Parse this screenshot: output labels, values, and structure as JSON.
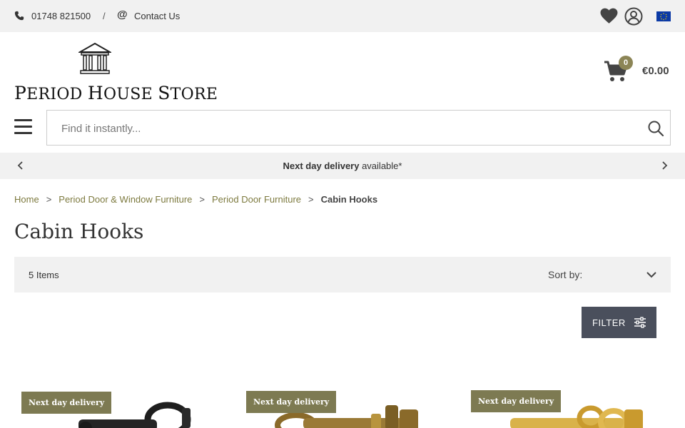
{
  "topbar": {
    "phone": "01748 821500",
    "separator": "/",
    "contact_label": "Contact Us"
  },
  "logo": {
    "text_first_letter_1": "P",
    "text_rest_1": "eriod ",
    "text_first_letter_2": "H",
    "text_rest_2": "ouse ",
    "text_first_letter_3": "S",
    "text_rest_3": "tore"
  },
  "cart": {
    "count": "0",
    "total": "€0.00"
  },
  "search": {
    "placeholder": "Find it instantly..."
  },
  "promo": {
    "bold": "Next day delivery",
    "rest": " available*"
  },
  "breadcrumb": {
    "items": [
      "Home",
      "Period Door & Window Furniture",
      "Period Door Furniture"
    ],
    "separator": ">",
    "current": "Cabin Hooks"
  },
  "page": {
    "title": "Cabin Hooks"
  },
  "toolbar": {
    "count": "5 Items",
    "sort_label": "Sort by:"
  },
  "filter": {
    "label": "FILTER"
  },
  "products": [
    {
      "badge": "Next day delivery",
      "finish": "black"
    },
    {
      "badge": "Next day delivery",
      "finish": "aged-brass"
    },
    {
      "badge": "Next day delivery",
      "finish": "polished-brass"
    }
  ],
  "colors": {
    "accent_olive": "#7d7a52",
    "link_olive": "#7d7a3f",
    "filter_button": "#4a4f5c",
    "eu_flag": "#0b3aa6"
  }
}
